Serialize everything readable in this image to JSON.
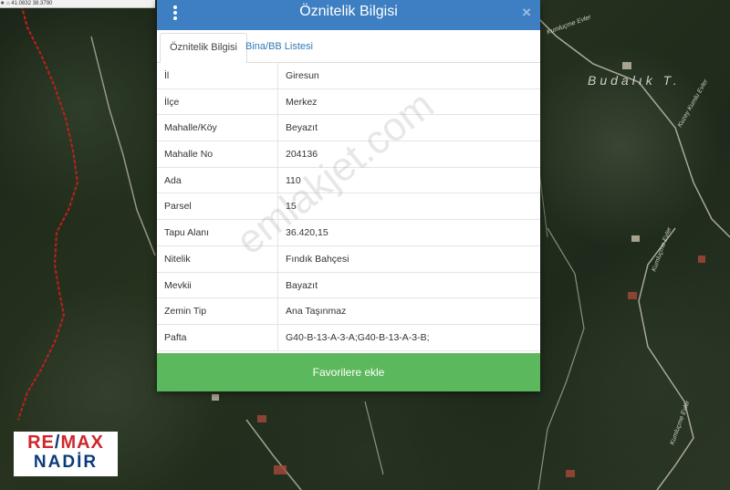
{
  "map": {
    "toolbar_text": "★   ⌂   41.0832 38.3790",
    "place_label": "Budalık T.",
    "road_labels": [
      "Kumluçme Evler",
      "Kuzey Kumlu Evler",
      "Kumluçme Evler",
      "Kumluçme Evler"
    ]
  },
  "logo": {
    "line1_re": "RE",
    "line1_slash": "/",
    "line1_max": "MAX",
    "line2": "NADİR"
  },
  "panel": {
    "title": "Öznitelik Bilgisi",
    "close_glyph": "×",
    "tabs": [
      "Öznitelik Bilgisi",
      "Bina/BB Listesi"
    ],
    "rows": [
      {
        "key": "İl",
        "value": "Giresun"
      },
      {
        "key": "İlçe",
        "value": "Merkez"
      },
      {
        "key": "Mahalle/Köy",
        "value": "Beyazıt"
      },
      {
        "key": "Mahalle No",
        "value": "204136"
      },
      {
        "key": "Ada",
        "value": "110"
      },
      {
        "key": "Parsel",
        "value": "15"
      },
      {
        "key": "Tapu Alanı",
        "value": "36.420,15"
      },
      {
        "key": "Nitelik",
        "value": "Fındık Bahçesi"
      },
      {
        "key": "Mevkii",
        "value": "Bayazıt"
      },
      {
        "key": "Zemin Tip",
        "value": "Ana Taşınmaz"
      },
      {
        "key": "Pafta",
        "value": "G40-B-13-A-3-A;G40-B-13-A-3-B;"
      }
    ],
    "favorite_button": "Favorilere ekle"
  },
  "watermark": "emlakjet.com",
  "colors": {
    "header": "#3d7fc2",
    "button": "#5cb85c",
    "parcel_boundary": "#c0201a"
  }
}
